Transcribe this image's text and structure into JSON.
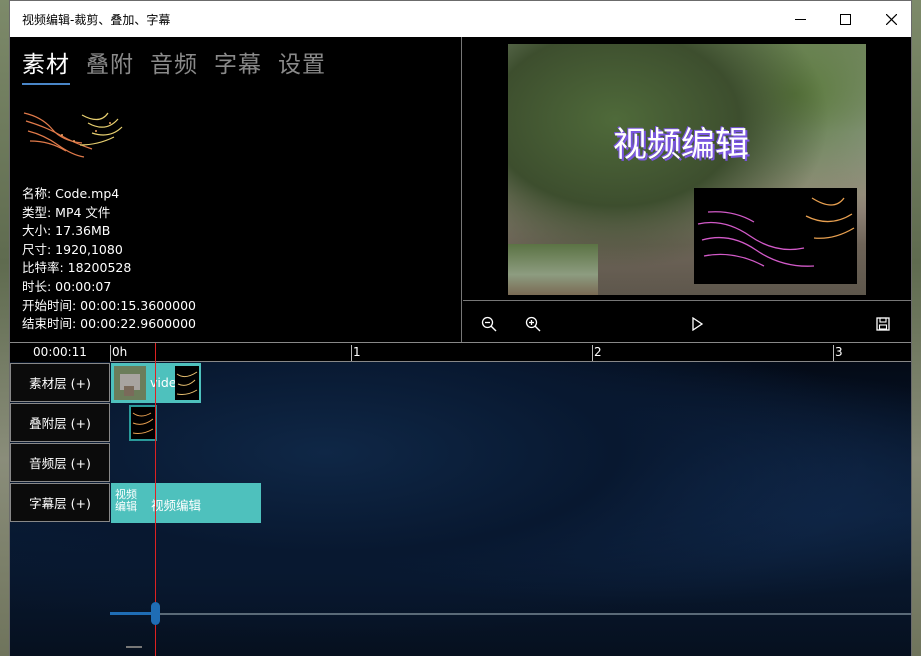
{
  "window": {
    "title": "视频编辑-裁剪、叠加、字幕"
  },
  "tabs": [
    "素材",
    "叠附",
    "音频",
    "字幕",
    "设置"
  ],
  "info": {
    "name": "名称: Code.mp4",
    "type": "类型: MP4 文件",
    "size": "大小: 17.36MB",
    "dimensions": "尺寸: 1920,1080",
    "bitrate": "比特率: 18200528",
    "duration": "时长: 00:00:07",
    "start": "开始时间: 00:00:15.3600000",
    "end": "结束时间: 00:00:22.9600000"
  },
  "preview": {
    "caption": "视频编辑"
  },
  "controls": [
    "zoom-out-icon",
    "zoom-in-icon",
    "play-icon",
    "save-icon"
  ],
  "timeline": {
    "current_time": "00:00:11",
    "ruler": [
      "0h",
      "1",
      "2",
      "3"
    ],
    "layers": [
      "素材层 (+)",
      "叠附层 (+)",
      "音频层 (+)",
      "字幕层 (+)"
    ],
    "clip_text_video": "vide",
    "clip_subtitle_thumb": "视频\n编辑",
    "clip_subtitle_text": "视频编辑"
  },
  "colors": {
    "clip": "#4ec1bd",
    "playhead": "#d22222",
    "accent": "#1f6db5",
    "caption_shadow": "#7a56e0"
  }
}
